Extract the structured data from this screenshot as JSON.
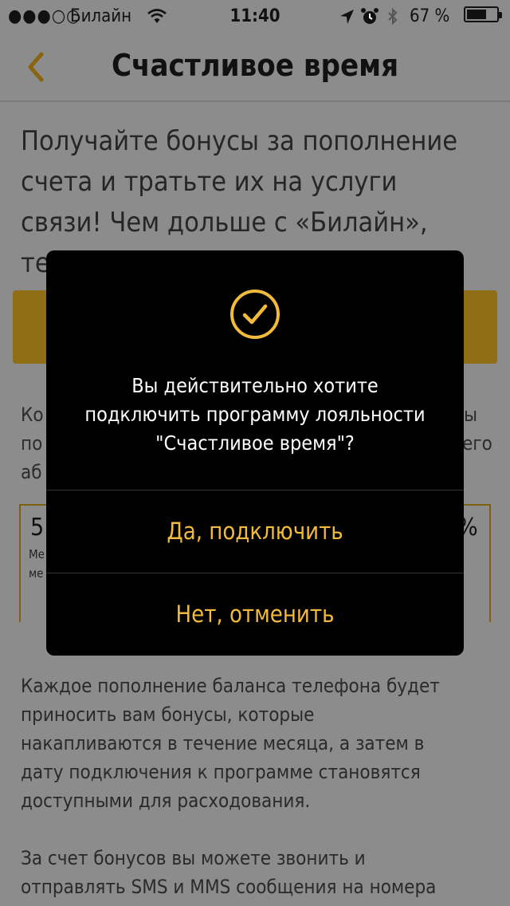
{
  "status_bar": {
    "signal": "●●●○○",
    "carrier": "Билайн",
    "time": "11:40",
    "battery_percent": "67 %",
    "battery_level": 0.67,
    "icons": [
      "wifi-icon",
      "location-icon",
      "alarm-icon",
      "bluetooth-icon",
      "battery-icon"
    ]
  },
  "nav": {
    "back_icon": "chevron-left-icon",
    "title": "Счастливое время"
  },
  "page": {
    "intro_lines": [
      "Получайте бонусы за пополнение",
      "счета и тратьте их на услуги",
      "связи! Чем дольше с «Билайн»,",
      "тем больше бонусов!"
    ],
    "mid_lines": [
      "Ко",
      "по",
      "аб"
    ],
    "mid_right_lines": [
      "ы",
      "его"
    ],
    "ribbon_left": {
      "big": "5",
      "small_1": "Ме",
      "small_2": "ме"
    },
    "ribbon_right": {
      "big": "%"
    },
    "description_lines": [
      "Каждое пополнение баланса телефона будет",
      "приносить вам бонусы, которые",
      "накапливаются в течение месяца, а затем в",
      "дату подключения к программе становятся",
      "доступными для расходования."
    ],
    "description2_lines": [
      "За счет бонусов вы можете звонить и",
      "отправлять SMS и MMS сообщения на номера"
    ]
  },
  "modal": {
    "icon": "checkmark-circle-icon",
    "message_lines": [
      "Вы действительно хотите",
      "подключить программу лояльности",
      "\"Счастливое время\"?"
    ],
    "confirm_label": "Да, подключить",
    "cancel_label": "Нет, отменить"
  },
  "colors": {
    "accent": "#f3bb3c",
    "modal_bg": "#000000",
    "overlay_page_bg": "#8c8c8c"
  }
}
